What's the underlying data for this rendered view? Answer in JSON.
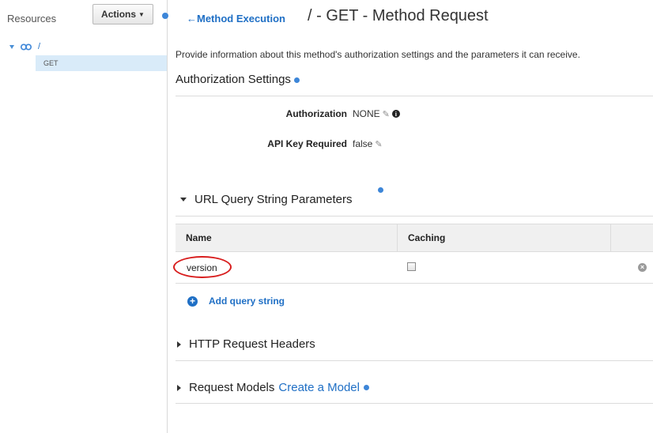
{
  "sidebar": {
    "resources_label": "Resources",
    "actions_label": "Actions",
    "tree": {
      "root_label": "/",
      "child_label": "GET"
    }
  },
  "header": {
    "back_link": "Method Execution",
    "title": "/ - GET - Method Request"
  },
  "intro_text": "Provide information about this method's authorization settings and the parameters it can receive.",
  "authorization": {
    "title": "Authorization Settings",
    "auth_label": "Authorization",
    "auth_value": "NONE",
    "api_key_label": "API Key Required",
    "api_key_value": "false"
  },
  "url_query": {
    "title": "URL Query String Parameters",
    "columns": [
      "Name",
      "Caching"
    ],
    "rows": [
      {
        "name": "version",
        "caching": false
      }
    ],
    "add_label": "Add query string"
  },
  "http_headers": {
    "title": "HTTP Request Headers"
  },
  "request_models": {
    "title": "Request Models",
    "link": "Create a Model"
  },
  "colors": {
    "accent": "#3d86d8",
    "link": "#1f6fc5",
    "highlight": "#d81e1e"
  }
}
